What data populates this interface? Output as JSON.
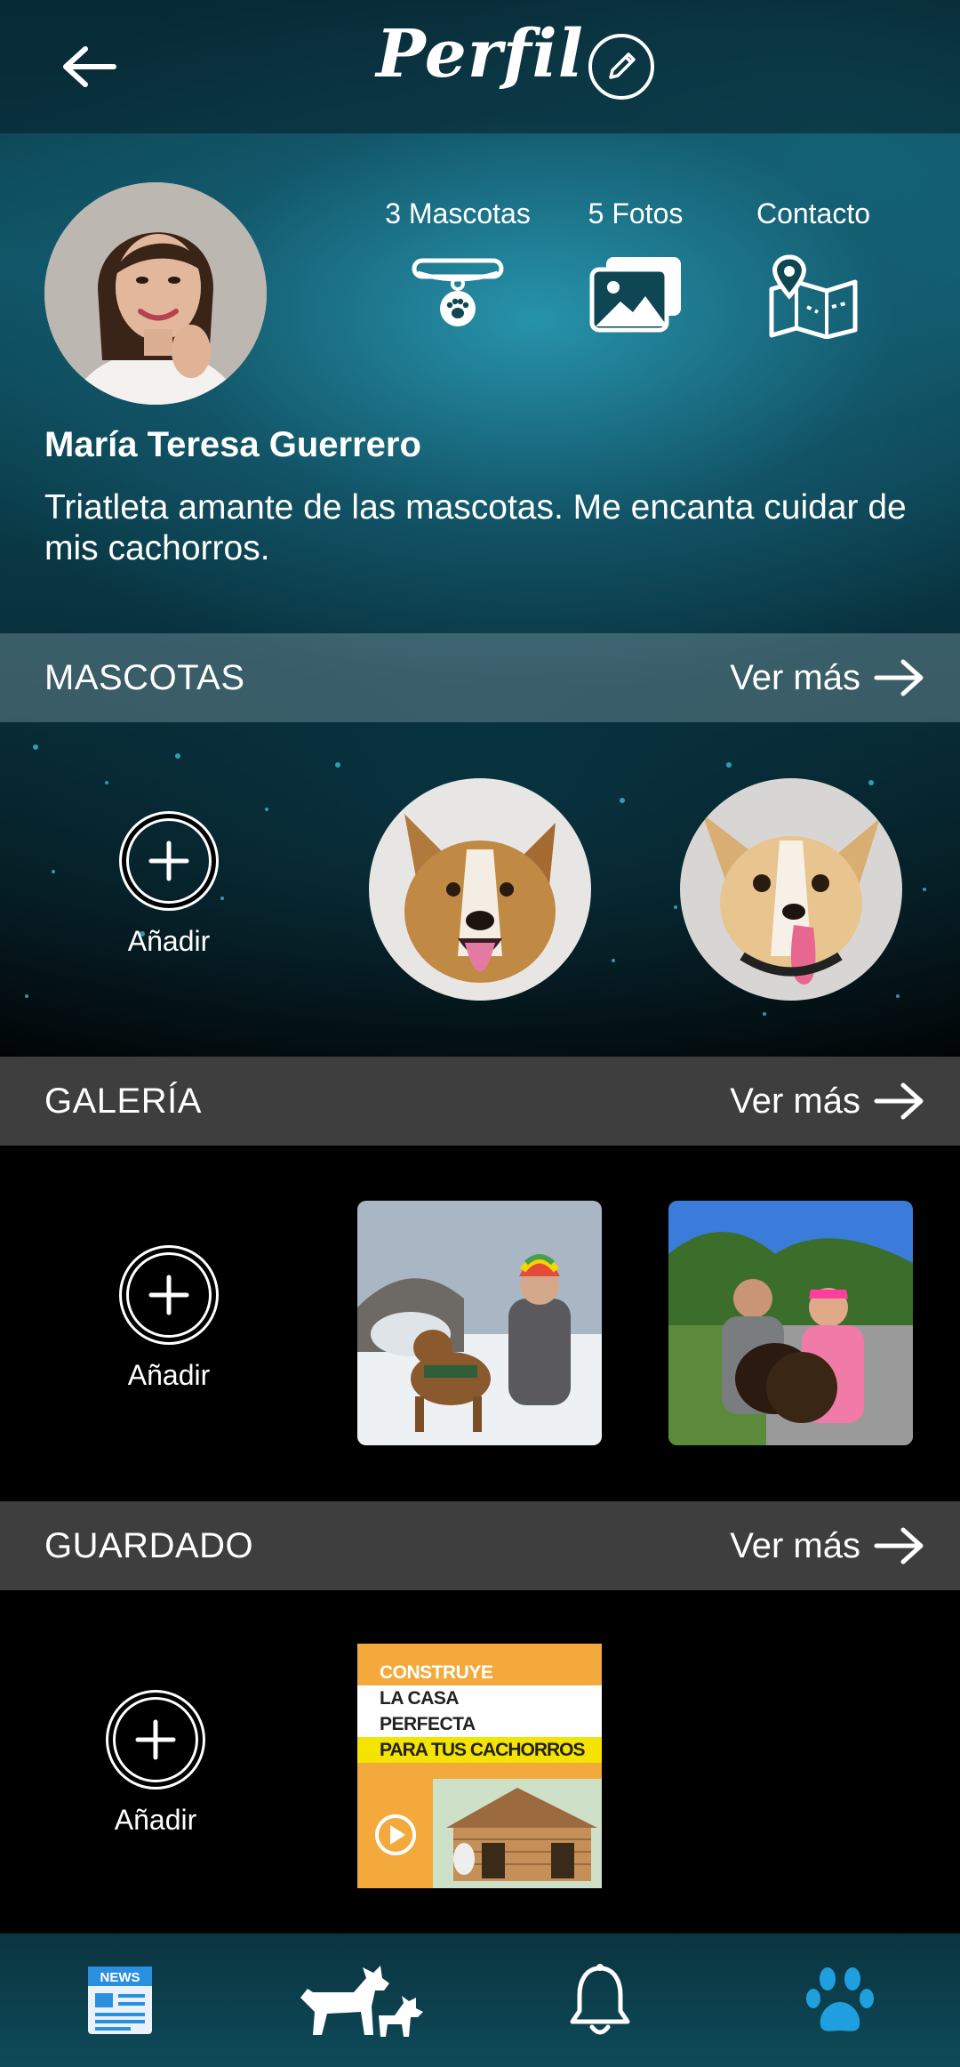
{
  "header": {
    "title": "Perfil"
  },
  "profile": {
    "name": "María Teresa Guerrero",
    "bio": "Triatleta amante de las mascotas. Me encanta cuidar de mis cachorros."
  },
  "stats": [
    {
      "label": "3 Mascotas",
      "icon": "pet-collar-icon"
    },
    {
      "label": "5 Fotos",
      "icon": "photos-icon"
    },
    {
      "label": "Contacto",
      "icon": "map-pin-icon"
    }
  ],
  "sections": {
    "mascotas": {
      "title": "MASCOTAS",
      "see_more": "Ver más",
      "add_label": "Añadir"
    },
    "galeria": {
      "title": "GALERÍA",
      "see_more": "Ver más",
      "add_label": "Añadir"
    },
    "guardado": {
      "title": "GUARDADO",
      "see_more": "Ver más",
      "add_label": "Añadir"
    }
  },
  "saved_item": {
    "lines": [
      "CONSTRUYE",
      "LA CASA",
      "PERFECTA",
      "PARA TUS CACHORROS"
    ]
  },
  "bottom_nav": [
    {
      "icon": "news-icon",
      "label": "NEWS"
    },
    {
      "icon": "dogs-icon"
    },
    {
      "icon": "bell-icon"
    },
    {
      "icon": "paw-icon",
      "active": true
    }
  ],
  "colors": {
    "accent_blue": "#1f9fe0",
    "saved_orange": "#f3a93b",
    "saved_yellow": "#f5e400"
  }
}
